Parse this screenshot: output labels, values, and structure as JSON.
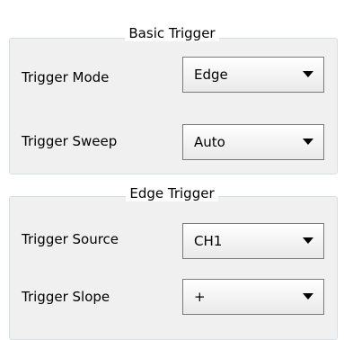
{
  "basic_trigger": {
    "title": "Basic Trigger",
    "rows": [
      {
        "label": "Trigger Mode",
        "value": "Edge"
      },
      {
        "label": "Trigger Sweep",
        "value": "Auto"
      }
    ]
  },
  "edge_trigger": {
    "title": "Edge Trigger",
    "rows": [
      {
        "label": "Trigger Source",
        "value": "CH1"
      },
      {
        "label": "Trigger Slope",
        "value": "+"
      }
    ]
  }
}
